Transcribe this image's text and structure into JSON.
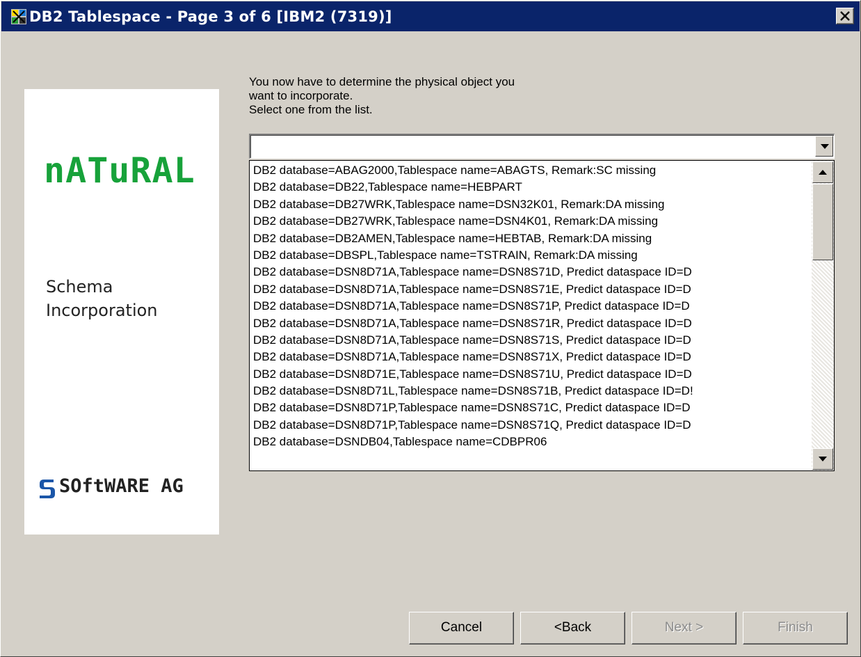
{
  "window": {
    "title": "DB2 Tablespace - Page 3 of 6 [IBM2 (7319)]",
    "title_bar_color": "#0a246a"
  },
  "branding": {
    "product": "nATuRAL",
    "subtitle_line1": "Schema",
    "subtitle_line2": "Incorporation",
    "company": "SOftWARE AG",
    "product_color": "#17a23a"
  },
  "instructions": {
    "line1": "You now have to determine the physical object you",
    "line2": "want to incorporate.",
    "line3": "Select one from the list."
  },
  "combo": {
    "value": ""
  },
  "list": {
    "items": [
      "DB2 database=ABAG2000,Tablespace name=ABAGTS, Remark:SC missing",
      "DB2 database=DB22,Tablespace name=HEBPART",
      "DB2 database=DB27WRK,Tablespace name=DSN32K01, Remark:DA missing",
      "DB2 database=DB27WRK,Tablespace name=DSN4K01, Remark:DA missing",
      "DB2 database=DB2AMEN,Tablespace name=HEBTAB, Remark:DA missing",
      "DB2 database=DBSPL,Tablespace name=TSTRAIN, Remark:DA missing",
      "DB2 database=DSN8D71A,Tablespace name=DSN8S71D, Predict dataspace ID=D",
      "DB2 database=DSN8D71A,Tablespace name=DSN8S71E, Predict dataspace ID=D",
      "DB2 database=DSN8D71A,Tablespace name=DSN8S71P, Predict dataspace ID=D",
      "DB2 database=DSN8D71A,Tablespace name=DSN8S71R, Predict dataspace ID=D",
      "DB2 database=DSN8D71A,Tablespace name=DSN8S71S, Predict dataspace ID=D",
      "DB2 database=DSN8D71A,Tablespace name=DSN8S71X, Predict dataspace ID=D",
      "DB2 database=DSN8D71E,Tablespace name=DSN8S71U, Predict dataspace ID=D",
      "DB2 database=DSN8D71L,Tablespace name=DSN8S71B, Predict dataspace ID=D!",
      "DB2 database=DSN8D71P,Tablespace name=DSN8S71C, Predict dataspace ID=D",
      "DB2 database=DSN8D71P,Tablespace name=DSN8S71Q, Predict dataspace ID=D",
      "DB2 database=DSNDB04,Tablespace name=CDBPR06"
    ]
  },
  "buttons": {
    "cancel": "Cancel",
    "back": "<Back",
    "next": "Next >",
    "finish": "Finish"
  },
  "icons": {
    "app": "wizard-app-icon",
    "close": "close-icon",
    "dropdown": "chevron-down-icon",
    "scroll_up": "arrow-up-icon",
    "scroll_down": "arrow-down-icon",
    "company_mark": "software-ag-mark-icon"
  }
}
